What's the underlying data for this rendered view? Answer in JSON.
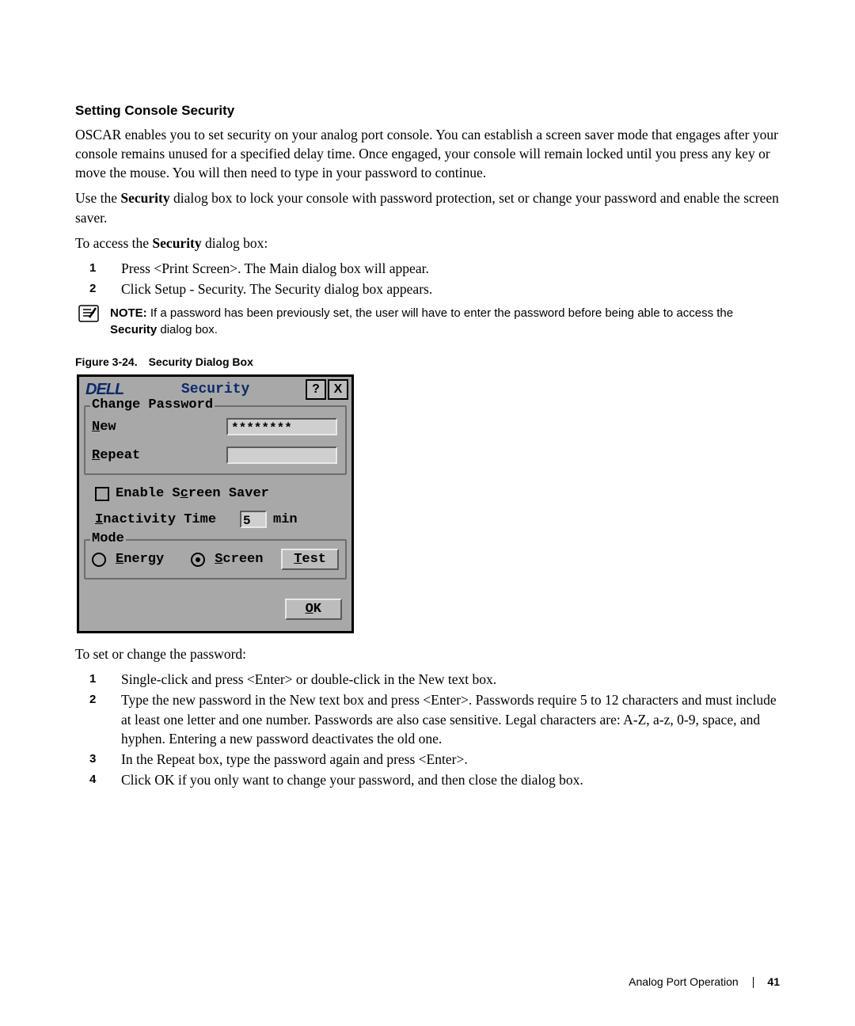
{
  "heading": "Setting Console Security",
  "para1": "OSCAR enables you to set security on your analog port console. You can establish a screen saver mode that engages after your console remains unused for a specified delay time. Once engaged, your console will remain locked until you press any key or move the mouse. You will then need to type in your password to continue.",
  "para2_a": "Use the ",
  "para2_b": "Security",
  "para2_c": " dialog box to lock your console with password protection, set or change your password and enable the screen saver.",
  "para3_a": "To access the ",
  "para3_b": "Security",
  "para3_c": " dialog box:",
  "list1": {
    "n1": "1",
    "t1_a": "Press <Print Screen>. The ",
    "t1_b": "Main",
    "t1_c": " dialog box will appear.",
    "n2": "2",
    "t2_a": "Click ",
    "t2_b": "Setup - Security",
    "t2_c": ". The ",
    "t2_d": "Security",
    "t2_e": " dialog box appears."
  },
  "note_label": "NOTE: ",
  "note_text_a": "If a password has been previously set, the user will have to enter the password before being able to access the ",
  "note_text_b": "Security",
  "note_text_c": " dialog box.",
  "figure_caption_a": "Figure 3-24.",
  "figure_caption_b": "Security Dialog Box",
  "dialog": {
    "logo": "DELL",
    "title": "Security",
    "help": "?",
    "close": "X",
    "group_change": "Change Password",
    "new_label_u": "N",
    "new_label_r": "ew",
    "new_value": "********",
    "repeat_label_u": "R",
    "repeat_label_r": "epeat",
    "repeat_value": "",
    "enable_a": "Enable S",
    "enable_u": "c",
    "enable_b": "reen Saver",
    "inactivity_u": "I",
    "inactivity_r": "nactivity Time",
    "inactivity_value": "5",
    "inactivity_unit": "min",
    "mode_legend": "Mode",
    "energy_u": "E",
    "energy_r": "nergy",
    "screen_u": "S",
    "screen_r": "creen",
    "test_u": "T",
    "test_r": "est",
    "ok_u": "O",
    "ok_r": "K"
  },
  "para4": "To set or change the password:",
  "list2": {
    "n1": "1",
    "t1_a": "Single-click and press <Enter> or double-click in the ",
    "t1_b": "New",
    "t1_c": " text box.",
    "n2": "2",
    "t2_a": "Type the new password in the ",
    "t2_b": "New",
    "t2_c": " text box and press <Enter>. Passwords require 5 to 12 characters and must include at least one letter and one number. Passwords are also case sensitive. Legal characters are: A-Z, a-z, 0-9, space, and hyphen. Entering a new password deactivates the old one.",
    "n3": "3",
    "t3_a": "In the ",
    "t3_b": "Repeat",
    "t3_c": " box, type the password again and press <Enter>.",
    "n4": "4",
    "t4_a": "Click ",
    "t4_b": "OK",
    "t4_c": " if you only want to change your password, and then close the dialog box."
  },
  "footer_section": "Analog Port Operation",
  "footer_page": "41"
}
